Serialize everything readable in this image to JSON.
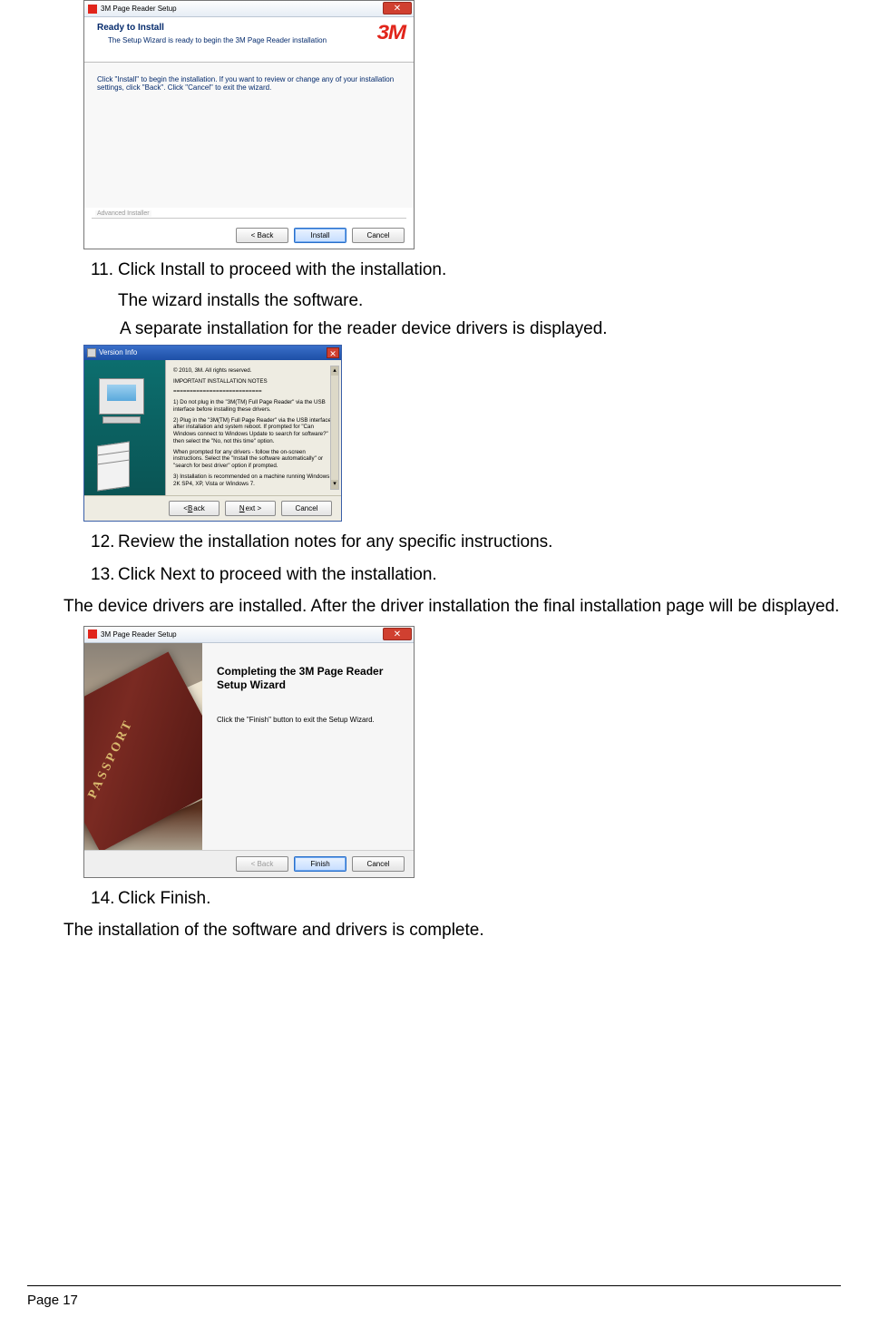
{
  "shot1": {
    "titlebar_app": "3M Page Reader Setup",
    "close_glyph": "✕",
    "header_title": "Ready to Install",
    "header_sub": "The Setup Wizard is ready to begin the 3M Page Reader installation",
    "brand": "3M",
    "body_text": "Click \"Install\" to begin the installation.  If you want to review or change any of your installation settings, click \"Back\".  Click \"Cancel\" to exit the wizard.",
    "fieldset_label": "Advanced Installer",
    "btn_back": "< Back",
    "btn_install": "Install",
    "btn_cancel": "Cancel"
  },
  "step11_num": "11.",
  "step11_text": "Click Install to proceed with the installation.",
  "step11_sub1": "The wizard installs the software.",
  "step11_sub2": "A separate installation for the reader device drivers is displayed.",
  "shot2": {
    "titlebar": "Version Info",
    "close_glyph": "✕",
    "scroll_up": "▴",
    "scroll_down": "▾",
    "copyright": "© 2010, 3M.  All rights reserved.",
    "notes_heading": "IMPORTANT INSTALLATION NOTES",
    "notes_rule": "===========================",
    "note1": "1) Do not plug in the \"3M(TM) Full Page Reader\" via the USB interface before installing these drivers.",
    "note2": "2) Plug in the \"3M(TM) Full Page Reader\" via the USB interface after installation and system reboot. If prompted for \"Can Windows connect to Windows Update to search for software?\" then select the \"No, not this time\" option.",
    "note3": "When prompted for any drivers - follow the on-screen instructions. Select the \"Install the software automatically\" or \"search for best driver\" option if prompted.",
    "note4": "3) Installation is recommended on a machine running Windows 2K SP4, XP, Vista or Windows 7.",
    "btn_back_u": "B",
    "btn_back_rest": "ack",
    "btn_next_u": "N",
    "btn_next_rest": "ext >",
    "btn_cancel": "Cancel"
  },
  "step12_num": "12.",
  "step12_text": "Review the installation notes for any specific instructions.",
  "step13_num": "13.",
  "step13_text": "Click Next to proceed with the installation.",
  "para_after13": "The device drivers are installed. After the driver installation the final installation page will be displayed.",
  "shot3": {
    "titlebar_app": "3M Page Reader Setup",
    "close_glyph": "✕",
    "passport": "PASSPORT",
    "title": "Completing the 3M Page Reader Setup Wizard",
    "sub": "Click the \"Finish\" button to exit the Setup Wizard.",
    "btn_back": "< Back",
    "btn_finish": "Finish",
    "btn_cancel": "Cancel"
  },
  "step14_num": "14.",
  "step14_text": "Click Finish.",
  "para_final": "The installation of the software and drivers is complete.",
  "page_number": "Page 17"
}
